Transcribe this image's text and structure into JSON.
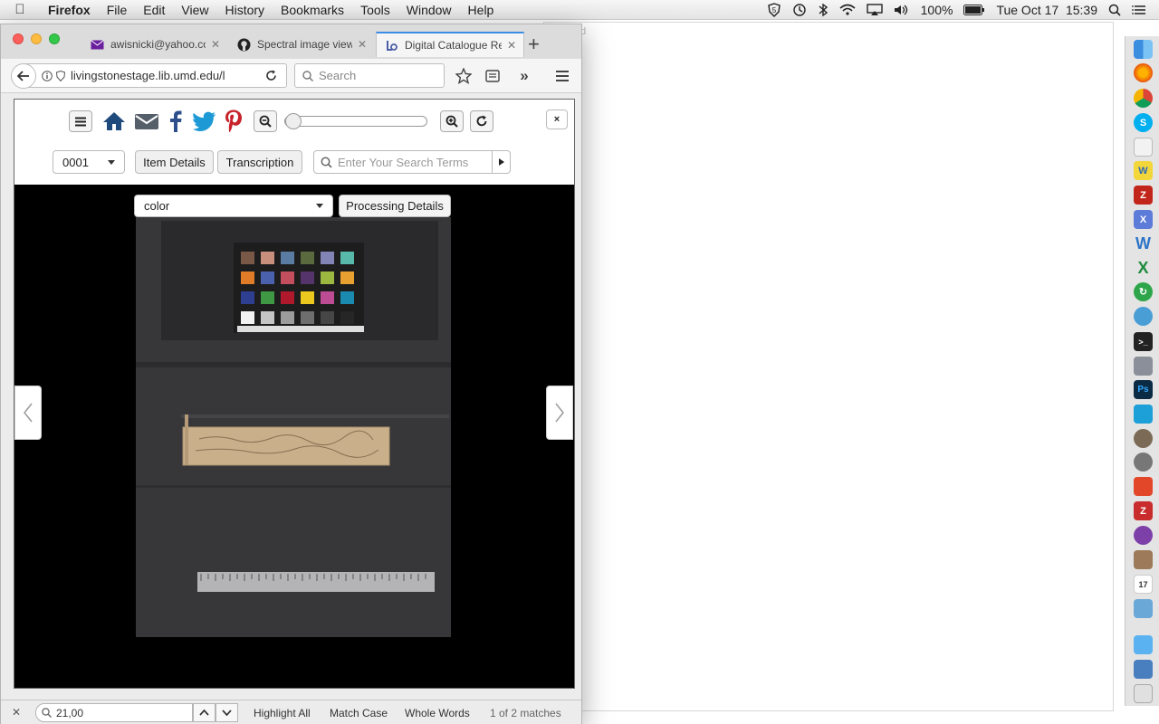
{
  "menubar": {
    "app": "Firefox",
    "items": [
      "File",
      "Edit",
      "View",
      "History",
      "Bookmarks",
      "Tools",
      "Window",
      "Help"
    ],
    "battery": "100%",
    "clock": "Tue Oct 17  15:39"
  },
  "browser": {
    "tabs": [
      {
        "title": "awisnicki@yahoo.co"
      },
      {
        "title": "Spectral image view"
      },
      {
        "title": "Digital Catalogue Re"
      }
    ],
    "url": "livingstonestage.lib.umd.edu/l",
    "search_placeholder": "Search"
  },
  "page": {
    "page_selector": "0001",
    "item_details_label": "Item Details",
    "transcription_label": "Transcription",
    "search_placeholder": "Enter Your Search Terms",
    "close_label": "×",
    "image_select": "color",
    "processing_details_label": "Processing Details",
    "colors": {
      "home": "#1f4b7c",
      "email": "#555f6a",
      "facebook": "#2d4f8b",
      "twitter": "#1d9ad6",
      "pinterest": "#c8232c"
    }
  },
  "findbar": {
    "query": "21,00",
    "highlight_all": "Highlight All",
    "match_case": "Match Case",
    "whole_words": "Whole Words",
    "status": "1 of 2 matches"
  },
  "background_fragment": "d"
}
